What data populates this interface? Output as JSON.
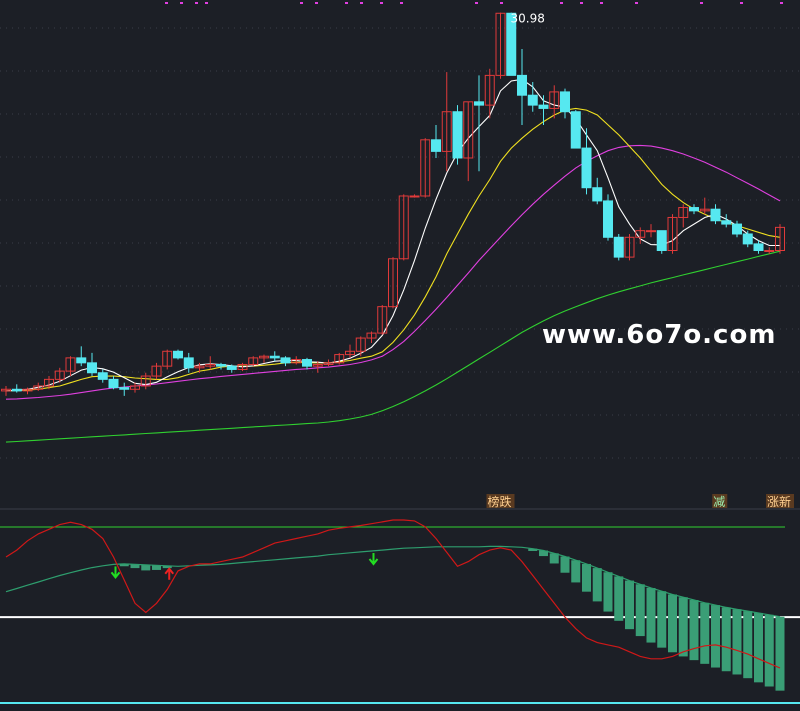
{
  "watermark": "www.6o7o.com",
  "colors": {
    "background": "#1c1f26",
    "up": "#e03a3a",
    "down": "#56e8f0",
    "ma5": "#ffffff",
    "ma10": "#f0e020",
    "ma20": "#e040e0",
    "ma60": "#30d030",
    "osc_red": "#d01818",
    "osc_green": "#2e9e6e",
    "bar_green": "#3a9e76",
    "tag_bg": "#5a3a20",
    "grid": "#3a3e48"
  },
  "chart_data": [
    {
      "type": "candlestick",
      "title": "",
      "peak_label": "30.98",
      "ylim": [
        16.4,
        31.2
      ],
      "grid": "horizontal dotted",
      "candles": [
        [
          19.55,
          19.7,
          19.4,
          19.6
        ],
        [
          19.6,
          19.75,
          19.5,
          19.55
        ],
        [
          19.55,
          19.65,
          19.45,
          19.6
        ],
        [
          19.6,
          19.8,
          19.55,
          19.7
        ],
        [
          19.7,
          20.0,
          19.6,
          19.9
        ],
        [
          19.9,
          20.25,
          19.8,
          20.15
        ],
        [
          20.15,
          20.6,
          20.0,
          20.55
        ],
        [
          20.55,
          20.9,
          20.3,
          20.4
        ],
        [
          20.4,
          20.7,
          20.0,
          20.1
        ],
        [
          20.1,
          20.2,
          19.8,
          19.9
        ],
        [
          19.9,
          20.0,
          19.6,
          19.65
        ],
        [
          19.65,
          19.8,
          19.4,
          19.6
        ],
        [
          19.6,
          19.8,
          19.5,
          19.7
        ],
        [
          19.7,
          20.1,
          19.6,
          20.0
        ],
        [
          20.0,
          20.4,
          19.9,
          20.3
        ],
        [
          20.3,
          20.8,
          20.2,
          20.75
        ],
        [
          20.75,
          20.8,
          20.5,
          20.55
        ],
        [
          20.55,
          20.7,
          20.1,
          20.25
        ],
        [
          20.25,
          20.4,
          20.1,
          20.3
        ],
        [
          20.3,
          20.6,
          20.2,
          20.35
        ],
        [
          20.35,
          20.4,
          20.2,
          20.3
        ],
        [
          20.3,
          20.35,
          20.1,
          20.2
        ],
        [
          20.2,
          20.4,
          20.15,
          20.35
        ],
        [
          20.35,
          20.6,
          20.3,
          20.55
        ],
        [
          20.55,
          20.65,
          20.4,
          20.6
        ],
        [
          20.6,
          20.75,
          20.45,
          20.55
        ],
        [
          20.55,
          20.6,
          20.3,
          20.4
        ],
        [
          20.4,
          20.6,
          20.35,
          20.5
        ],
        [
          20.5,
          20.55,
          20.2,
          20.3
        ],
        [
          20.3,
          20.45,
          20.1,
          20.35
        ],
        [
          20.35,
          20.5,
          20.3,
          20.4
        ],
        [
          20.4,
          20.7,
          20.35,
          20.65
        ],
        [
          20.65,
          20.95,
          20.55,
          20.75
        ],
        [
          20.75,
          21.2,
          20.6,
          21.15
        ],
        [
          21.15,
          21.35,
          21.0,
          21.3
        ],
        [
          21.3,
          22.15,
          21.25,
          22.1
        ],
        [
          22.1,
          23.6,
          22.05,
          23.55
        ],
        [
          23.55,
          25.5,
          23.5,
          25.45
        ],
        [
          25.45,
          25.5,
          25.4,
          25.45
        ],
        [
          25.45,
          27.2,
          25.4,
          27.15
        ],
        [
          27.15,
          27.6,
          26.6,
          26.8
        ],
        [
          26.8,
          29.2,
          26.2,
          28.0
        ],
        [
          28.0,
          28.2,
          26.4,
          26.6
        ],
        [
          26.6,
          28.3,
          25.9,
          28.3
        ],
        [
          28.3,
          29.1,
          26.2,
          28.2
        ],
        [
          28.2,
          29.3,
          27.8,
          29.1
        ],
        [
          29.1,
          31.0,
          29.0,
          30.98
        ],
        [
          30.98,
          31.0,
          29.1,
          29.1
        ],
        [
          29.1,
          29.9,
          27.6,
          28.5
        ],
        [
          28.5,
          28.9,
          28.0,
          28.2
        ],
        [
          28.2,
          28.5,
          27.6,
          28.1
        ],
        [
          28.1,
          28.8,
          27.8,
          28.6
        ],
        [
          28.6,
          28.7,
          27.8,
          28.0
        ],
        [
          28.0,
          28.05,
          26.9,
          26.9
        ],
        [
          26.9,
          27.5,
          25.5,
          25.7
        ],
        [
          25.7,
          26.0,
          25.2,
          25.3
        ],
        [
          25.3,
          25.5,
          24.1,
          24.2
        ],
        [
          24.2,
          24.3,
          23.5,
          23.6
        ],
        [
          23.6,
          24.3,
          23.5,
          24.2
        ],
        [
          24.2,
          24.5,
          24.0,
          24.4
        ],
        [
          24.4,
          24.6,
          24.2,
          24.4
        ],
        [
          24.4,
          24.4,
          23.7,
          23.8
        ],
        [
          23.8,
          24.9,
          23.7,
          24.8
        ],
        [
          24.8,
          25.2,
          24.5,
          25.1
        ],
        [
          25.1,
          25.2,
          24.9,
          25.0
        ],
        [
          25.0,
          25.4,
          24.9,
          25.05
        ],
        [
          25.05,
          25.2,
          24.6,
          24.7
        ],
        [
          24.7,
          24.9,
          24.5,
          24.6
        ],
        [
          24.6,
          24.7,
          24.2,
          24.3
        ],
        [
          24.3,
          24.4,
          23.9,
          24.0
        ],
        [
          24.0,
          24.1,
          23.7,
          23.8
        ],
        [
          23.8,
          23.9,
          23.7,
          23.8
        ],
        [
          23.8,
          24.6,
          23.7,
          24.5
        ]
      ],
      "ma5": [
        19.55,
        19.57,
        19.6,
        19.66,
        19.73,
        19.84,
        20.01,
        20.18,
        20.26,
        20.22,
        20.12,
        19.95,
        19.78,
        19.74,
        19.81,
        19.98,
        20.13,
        20.26,
        20.34,
        20.37,
        20.35,
        20.31,
        20.28,
        20.31,
        20.38,
        20.45,
        20.47,
        20.47,
        20.43,
        20.42,
        20.39,
        20.45,
        20.54,
        20.69,
        20.87,
        21.23,
        21.83,
        22.61,
        23.5,
        24.48,
        25.35,
        26.15,
        26.76,
        27.2,
        27.55,
        27.89,
        28.63,
        28.93,
        28.98,
        28.75,
        28.33,
        28.2,
        28.14,
        27.78,
        27.3,
        26.82,
        26.0,
        25.12,
        24.6,
        24.15,
        23.98,
        23.97,
        24.1,
        24.4,
        24.6,
        24.8,
        24.9,
        24.75,
        24.55,
        24.3,
        24.1,
        23.95,
        23.95
      ],
      "ma10": [
        19.55,
        19.56,
        19.58,
        19.6,
        19.65,
        19.7,
        19.8,
        19.9,
        19.98,
        20.0,
        20.0,
        19.98,
        19.94,
        19.92,
        19.9,
        19.9,
        19.95,
        20.05,
        20.15,
        20.2,
        20.27,
        20.3,
        20.3,
        20.3,
        20.33,
        20.36,
        20.4,
        20.42,
        20.4,
        20.4,
        20.4,
        20.43,
        20.47,
        20.54,
        20.6,
        20.73,
        21.02,
        21.4,
        21.85,
        22.4,
        23.0,
        23.7,
        24.3,
        24.9,
        25.45,
        25.95,
        26.5,
        26.9,
        27.2,
        27.47,
        27.7,
        27.9,
        28.05,
        28.1,
        28.05,
        27.9,
        27.6,
        27.3,
        26.95,
        26.6,
        26.2,
        25.8,
        25.5,
        25.25,
        25.05,
        24.9,
        24.75,
        24.65,
        24.55,
        24.45,
        24.35,
        24.25,
        24.2
      ],
      "ma20": [
        19.3,
        19.31,
        19.33,
        19.35,
        19.38,
        19.41,
        19.45,
        19.5,
        19.55,
        19.6,
        19.64,
        19.67,
        19.7,
        19.73,
        19.76,
        19.8,
        19.84,
        19.88,
        19.92,
        19.95,
        19.99,
        20.02,
        20.05,
        20.08,
        20.11,
        20.14,
        20.17,
        20.2,
        20.22,
        20.25,
        20.27,
        20.31,
        20.35,
        20.41,
        20.49,
        20.6,
        20.8,
        21.05,
        21.35,
        21.68,
        22.02,
        22.38,
        22.75,
        23.12,
        23.5,
        23.85,
        24.2,
        24.55,
        24.88,
        25.2,
        25.5,
        25.78,
        26.05,
        26.3,
        26.5,
        26.67,
        26.82,
        26.92,
        26.97,
        26.98,
        26.96,
        26.9,
        26.82,
        26.72,
        26.6,
        26.47,
        26.32,
        26.17,
        26.0,
        25.83,
        25.66,
        25.48,
        25.3
      ],
      "ma60": [
        18.0,
        18.02,
        18.04,
        18.06,
        18.08,
        18.1,
        18.12,
        18.14,
        18.16,
        18.18,
        18.2,
        18.22,
        18.24,
        18.26,
        18.28,
        18.3,
        18.32,
        18.34,
        18.36,
        18.38,
        18.4,
        18.42,
        18.44,
        18.46,
        18.48,
        18.5,
        18.52,
        18.54,
        18.56,
        18.58,
        18.61,
        18.65,
        18.7,
        18.76,
        18.84,
        18.95,
        19.08,
        19.22,
        19.38,
        19.55,
        19.73,
        19.92,
        20.12,
        20.32,
        20.52,
        20.72,
        20.92,
        21.12,
        21.32,
        21.5,
        21.67,
        21.83,
        21.97,
        22.1,
        22.22,
        22.34,
        22.45,
        22.55,
        22.64,
        22.73,
        22.82,
        22.9,
        22.98,
        23.06,
        23.14,
        23.22,
        23.3,
        23.38,
        23.46,
        23.54,
        23.62,
        23.7,
        23.78
      ]
    },
    {
      "type": "oscillator",
      "ylim": [
        -2.2,
        1.0
      ],
      "reference_levels": [
        0.85,
        -1.1
      ],
      "tags": [
        {
          "index": 46,
          "text": "榜跌"
        },
        {
          "index": 67,
          "text": "减"
        },
        {
          "index": 72,
          "text": "涨新"
        }
      ],
      "red_line": [
        0.2,
        0.35,
        0.55,
        0.7,
        0.8,
        0.9,
        0.95,
        0.9,
        0.8,
        0.6,
        0.2,
        -0.3,
        -0.8,
        -1.0,
        -0.8,
        -0.5,
        -0.1,
        0.0,
        0.05,
        0.05,
        0.1,
        0.15,
        0.2,
        0.3,
        0.4,
        0.5,
        0.55,
        0.6,
        0.65,
        0.7,
        0.78,
        0.82,
        0.85,
        0.88,
        0.92,
        0.96,
        1.0,
        1.0,
        0.98,
        0.85,
        0.6,
        0.3,
        0.0,
        0.1,
        0.25,
        0.35,
        0.4,
        0.35,
        0.1,
        -0.2,
        -0.5,
        -0.8,
        -1.1,
        -1.35,
        -1.55,
        -1.65,
        -1.7,
        -1.75,
        -1.85,
        -1.95,
        -2.0,
        -2.0,
        -1.95,
        -1.85,
        -1.78,
        -1.72,
        -1.7,
        -1.75,
        -1.82,
        -1.9,
        -2.0,
        -2.1,
        -2.2
      ],
      "green_line": [
        -0.55,
        -0.48,
        -0.41,
        -0.34,
        -0.27,
        -0.2,
        -0.14,
        -0.08,
        -0.03,
        0.01,
        0.04,
        0.05,
        0.04,
        0.03,
        0.02,
        0.01,
        0.0,
        0.01,
        0.02,
        0.03,
        0.04,
        0.06,
        0.08,
        0.1,
        0.12,
        0.14,
        0.16,
        0.18,
        0.2,
        0.22,
        0.25,
        0.27,
        0.29,
        0.31,
        0.33,
        0.35,
        0.37,
        0.39,
        0.4,
        0.41,
        0.42,
        0.42,
        0.42,
        0.42,
        0.42,
        0.43,
        0.43,
        0.42,
        0.41,
        0.38,
        0.34,
        0.28,
        0.21,
        0.13,
        0.05,
        -0.04,
        -0.13,
        -0.22,
        -0.31,
        -0.39,
        -0.47,
        -0.54,
        -0.61,
        -0.67,
        -0.73,
        -0.79,
        -0.84,
        -0.89,
        -0.93,
        -0.97,
        -1.01,
        -1.05,
        -1.09
      ],
      "histogram": [
        0,
        0,
        0,
        0,
        0,
        0,
        0,
        0,
        0,
        0,
        0,
        -0.05,
        -0.08,
        -0.12,
        -0.1,
        -0.05,
        0,
        0,
        0,
        0,
        0,
        0,
        0,
        0,
        0,
        0,
        0,
        0,
        0,
        0,
        0,
        0,
        0,
        0,
        0,
        0,
        0,
        0,
        0,
        0,
        0,
        0,
        0,
        0,
        0,
        0,
        0,
        0,
        0.0,
        -0.05,
        -0.12,
        -0.22,
        -0.35,
        -0.48,
        -0.6,
        -0.72,
        -0.85,
        -0.96,
        -1.05,
        -1.12,
        -1.18,
        -1.22,
        -1.25,
        -1.28,
        -1.3,
        -1.32,
        -1.35,
        -1.38,
        -1.41,
        -1.45,
        -1.5,
        -1.55,
        -1.6
      ],
      "markers": [
        {
          "index": 10,
          "kind": "down",
          "color": "#22dd22"
        },
        {
          "index": 15,
          "kind": "up",
          "color": "#ee2222"
        },
        {
          "index": 34,
          "kind": "down",
          "color": "#22dd22"
        }
      ]
    }
  ]
}
